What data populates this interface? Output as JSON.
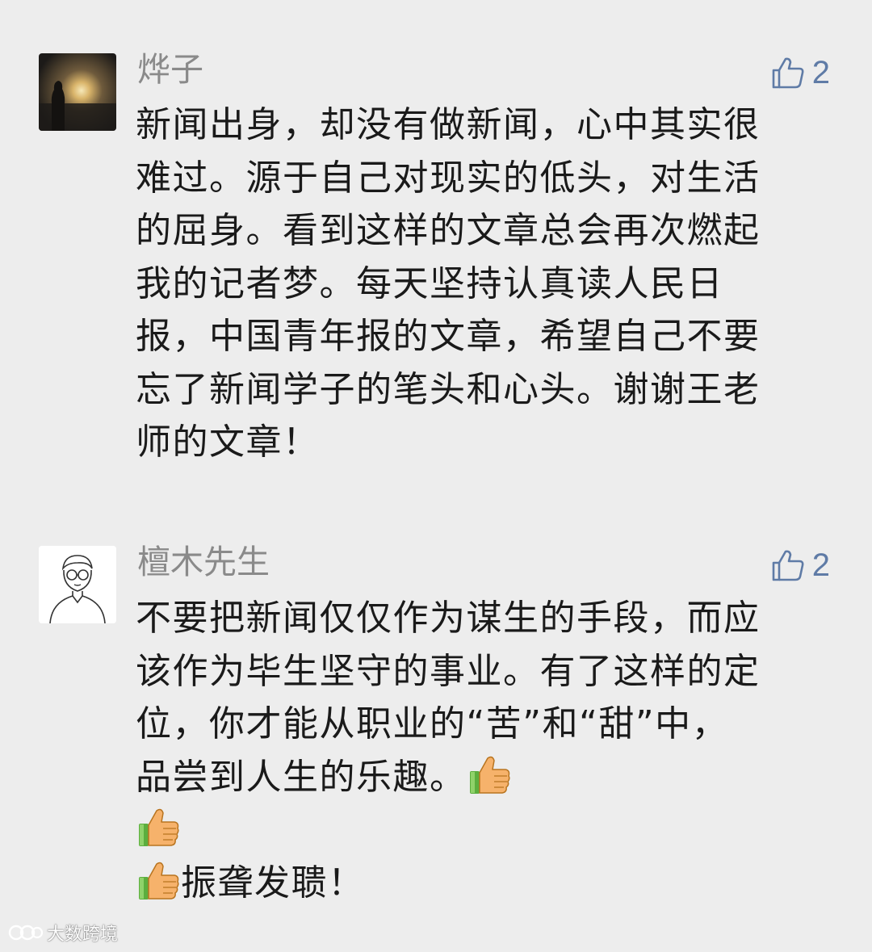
{
  "comments": [
    {
      "author": "烨子",
      "avatar_icon": "sunset-silhouette-avatar",
      "likes": "2",
      "lines": [
        "新闻出身，却没有做新闻，心中其实很",
        "难过。源于自己对现实的低头，对生活",
        "的屈身。看到这样的文章总会再次燃起",
        "我的记者梦。每天坚持认真读人民日",
        "报，中国青年报的文章，希望自己不要",
        "忘了新闻学子的笔头和心头。谢谢王老",
        "师的文章！"
      ]
    },
    {
      "author": "檀木先生",
      "avatar_icon": "cartoon-man-glasses-avatar",
      "likes": "2",
      "lines": [
        "不要把新闻仅仅作为谋生的手段，而应",
        "该作为毕生坚守的事业。有了这样的定",
        "位，你才能从职业的“苦”和“甜”中，",
        "品尝到人生的乐趣。"
      ],
      "extra_lines": [
        "",
        "振聋发聩！"
      ]
    }
  ],
  "watermark": {
    "text": "大数跨境"
  },
  "colors": {
    "background": "#ededed",
    "name": "#8a8a8a",
    "like": "#5f7ba6",
    "text": "#1a1a1a"
  }
}
